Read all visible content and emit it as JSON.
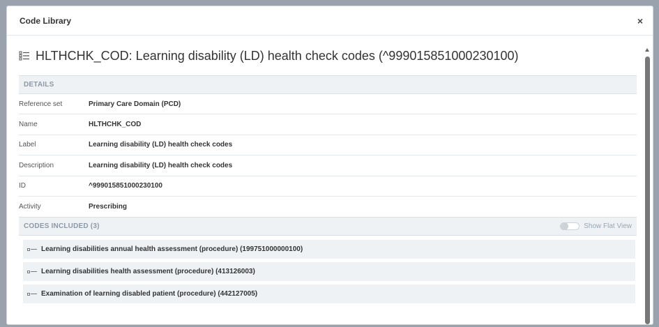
{
  "modal": {
    "title": "Code Library",
    "close_label": "×"
  },
  "concept": {
    "title": "HLTHCHK_COD: Learning disability (LD) health check codes (^999015851000230100)"
  },
  "details": {
    "section_label": "DETAILS",
    "rows": [
      {
        "key": "Reference set",
        "value": "Primary Care Domain (PCD)"
      },
      {
        "key": "Name",
        "value": "HLTHCHK_COD"
      },
      {
        "key": "Label",
        "value": "Learning disability (LD) health check codes"
      },
      {
        "key": "Description",
        "value": "Learning disability (LD) health check codes"
      },
      {
        "key": "ID",
        "value": "^999015851000230100"
      },
      {
        "key": "Activity",
        "value": "Prescribing"
      }
    ]
  },
  "codes": {
    "section_label": "CODES INCLUDED (3)",
    "toggle_label": "Show Flat View",
    "toggle_on": false,
    "items": [
      {
        "label": "Learning disabilities annual health assessment (procedure) (199751000000100)"
      },
      {
        "label": "Learning disabilities health assessment (procedure) (413126003)"
      },
      {
        "label": "Examination of learning disabled patient (procedure) (442127005)"
      }
    ]
  },
  "icons": {
    "list": "list-icon",
    "scroll_up": "triangle-up-icon"
  },
  "colors": {
    "section_bg": "#eef2f5",
    "section_text": "#8d99a6",
    "border": "#d9dfe4"
  }
}
